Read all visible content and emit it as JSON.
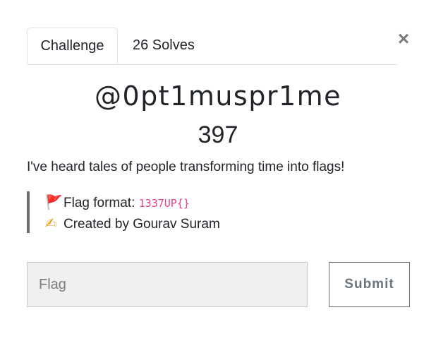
{
  "tabs": [
    {
      "label": "Challenge",
      "active": true
    },
    {
      "label": "26 Solves",
      "active": false
    }
  ],
  "close_glyph": "×",
  "challenge": {
    "name": "@0pt1muspr1me",
    "points": "397",
    "description": "I've heard tales of people transforming time into flags!",
    "notes": {
      "flag_icon": "🚩",
      "flag_format_label": "Flag format: ",
      "flag_format_value": "1337UP{}",
      "author_icon": "✍",
      "author_text": "Created by Gourav Suram"
    }
  },
  "form": {
    "flag_placeholder": "Flag",
    "flag_value": "",
    "submit_label": "Submit"
  },
  "colors": {
    "code": "#e83e8c",
    "quote_border": "#6c6c6c",
    "input_bg": "#f0f0f0"
  }
}
